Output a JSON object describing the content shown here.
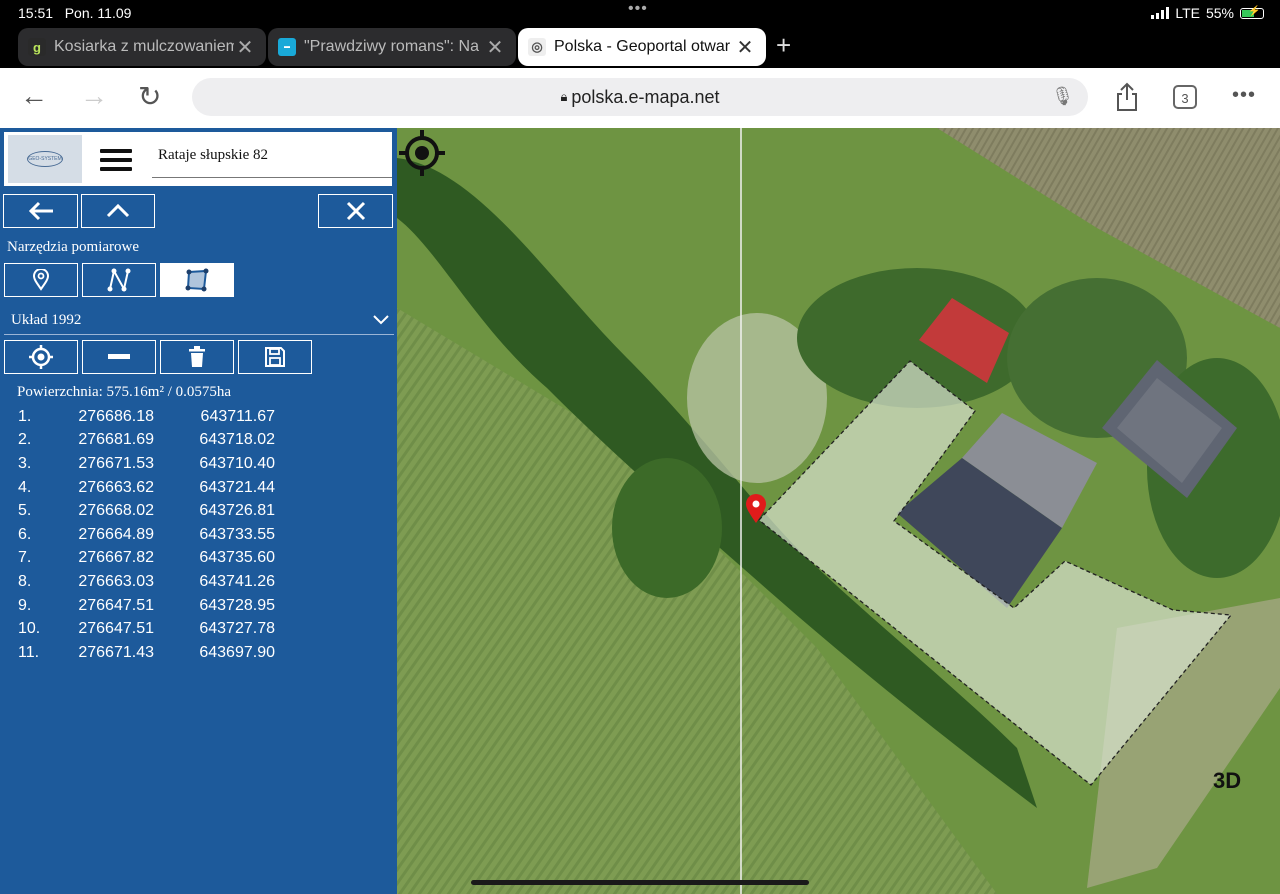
{
  "status": {
    "time": "15:51",
    "date": "Pon. 11.09",
    "network": "LTE",
    "battery": "55%"
  },
  "tabs": [
    {
      "title": "Kosiarka z mulczowaniem",
      "favicon": "g"
    },
    {
      "title": "\"Prawdziwy romans\": Na",
      "favicon": ""
    },
    {
      "title": "Polska - Geoportal otwar",
      "favicon": ""
    }
  ],
  "browser": {
    "url": "polska.e-mapa.net",
    "tab_count": "3"
  },
  "panel": {
    "logo_text": "GEO-SYSTEM",
    "search_value": "Rataje słupskie 82",
    "tools_label": "Narzędzia pomiarowe",
    "coord_system": "Układ 1992",
    "area": "Powierzchnia: 575.16m² / 0.0575ha",
    "points": [
      {
        "n": "1.",
        "x": "276686.18",
        "y": "643711.67"
      },
      {
        "n": "2.",
        "x": "276681.69",
        "y": "643718.02"
      },
      {
        "n": "3.",
        "x": "276671.53",
        "y": "643710.40"
      },
      {
        "n": "4.",
        "x": "276663.62",
        "y": "643721.44"
      },
      {
        "n": "5.",
        "x": "276668.02",
        "y": "643726.81"
      },
      {
        "n": "6.",
        "x": "276664.89",
        "y": "643733.55"
      },
      {
        "n": "7.",
        "x": "276667.82",
        "y": "643735.60"
      },
      {
        "n": "8.",
        "x": "276663.03",
        "y": "643741.26"
      },
      {
        "n": "9.",
        "x": "276647.51",
        "y": "643728.95"
      },
      {
        "n": "10.",
        "x": "276647.51",
        "y": "643727.78"
      },
      {
        "n": "11.",
        "x": "276671.43",
        "y": "643697.90"
      }
    ]
  },
  "map": {
    "btn_3d": "3D"
  }
}
